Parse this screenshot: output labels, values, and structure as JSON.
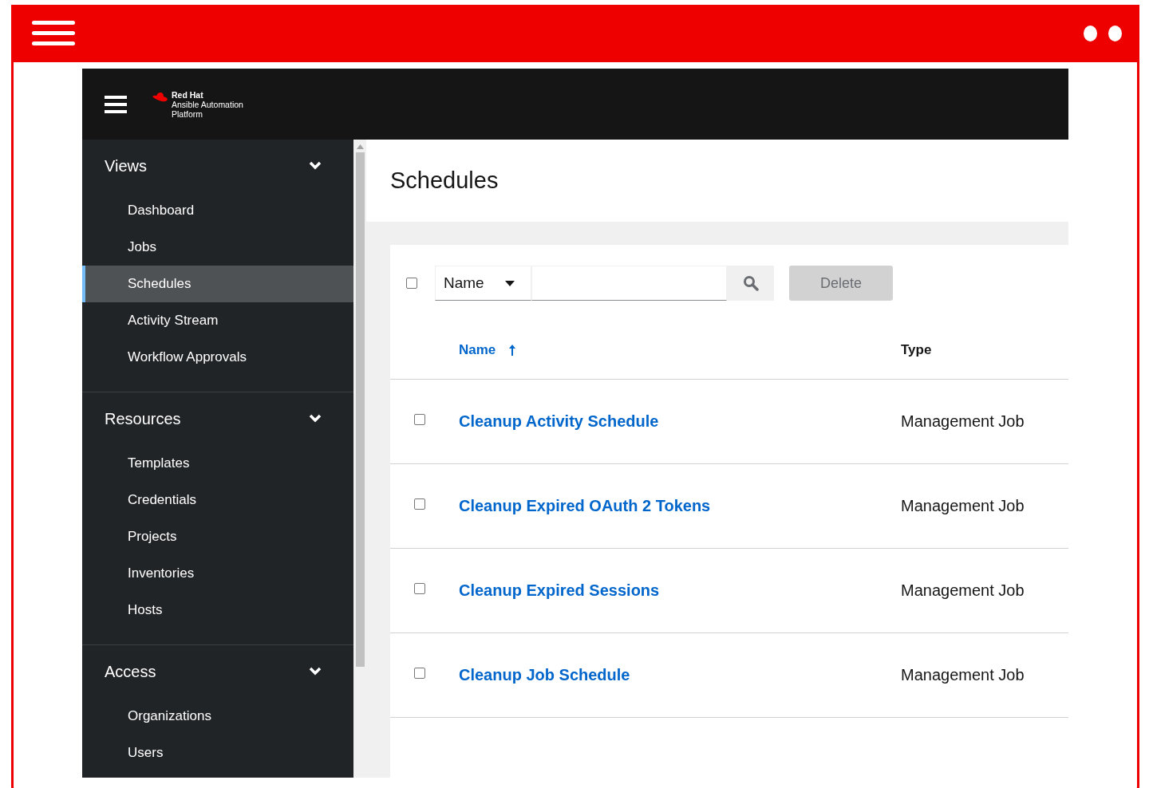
{
  "brand": {
    "name": "Red Hat",
    "product_lines": [
      "Ansible Automation",
      "Platform"
    ]
  },
  "sidebar": {
    "groups": [
      {
        "label": "Views",
        "expanded": true,
        "items": [
          {
            "label": "Dashboard",
            "selected": false
          },
          {
            "label": "Jobs",
            "selected": false
          },
          {
            "label": "Schedules",
            "selected": true
          },
          {
            "label": "Activity Stream",
            "selected": false
          },
          {
            "label": "Workflow Approvals",
            "selected": false
          }
        ]
      },
      {
        "label": "Resources",
        "expanded": true,
        "items": [
          {
            "label": "Templates",
            "selected": false
          },
          {
            "label": "Credentials",
            "selected": false
          },
          {
            "label": "Projects",
            "selected": false
          },
          {
            "label": "Inventories",
            "selected": false
          },
          {
            "label": "Hosts",
            "selected": false
          }
        ]
      },
      {
        "label": "Access",
        "expanded": true,
        "items": [
          {
            "label": "Organizations",
            "selected": false
          },
          {
            "label": "Users",
            "selected": false
          }
        ]
      }
    ]
  },
  "page": {
    "title": "Schedules"
  },
  "toolbar": {
    "select_all": {
      "checked": false
    },
    "filter": {
      "value": "Name"
    },
    "delete": {
      "label": "Delete",
      "disabled": true
    }
  },
  "table": {
    "columns": [
      {
        "label": "Name",
        "sorted": true
      },
      {
        "label": "Type",
        "sorted": false
      }
    ],
    "rows": [
      {
        "checked": false,
        "name": "Cleanup Activity Schedule",
        "type": "Management Job"
      },
      {
        "checked": false,
        "name": "Cleanup Expired OAuth 2 Tokens",
        "type": "Management Job"
      },
      {
        "checked": false,
        "name": "Cleanup Expired Sessions",
        "type": "Management Job"
      },
      {
        "checked": false,
        "name": "Cleanup Job Schedule",
        "type": "Management Job"
      }
    ]
  }
}
